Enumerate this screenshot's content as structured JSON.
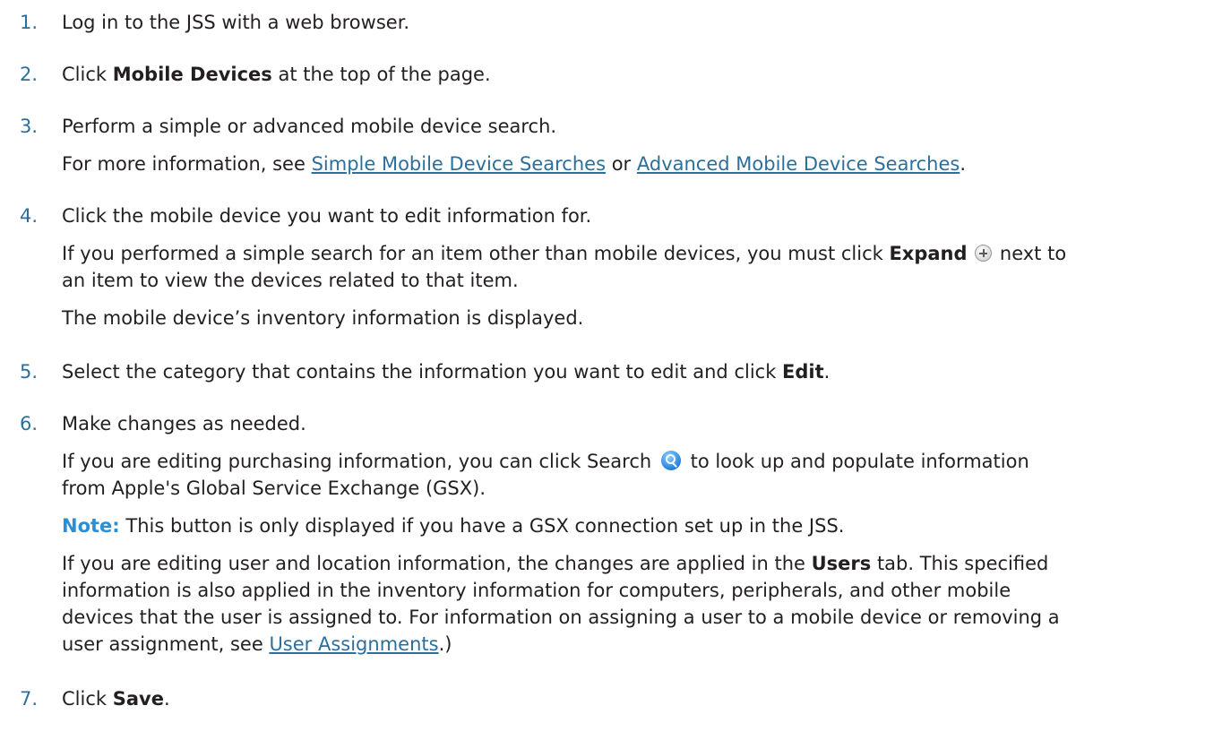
{
  "steps": [
    {
      "num": "1.",
      "text": "Log in to the JSS with a web browser."
    },
    {
      "num": "2.",
      "pre": "Click ",
      "bold": "Mobile Devices",
      "post": " at the top of the page."
    },
    {
      "num": "3.",
      "text": "Perform a simple or advanced mobile device search.",
      "sub_pre": "For more information, see ",
      "link1": "Simple Mobile Device Searches",
      "sub_mid": " or ",
      "link2": "Advanced Mobile Device Searches",
      "sub_post": "."
    },
    {
      "num": "4.",
      "text": "Click the mobile device you want to edit information for.",
      "p1_pre": "If you performed a simple search for an item other than mobile devices, you must click ",
      "p1_bold": "Expand",
      "p1_post1": " next to",
      "p1_post2": "an item to view the devices related to that item.",
      "p2": "The mobile device’s inventory information is displayed."
    },
    {
      "num": "5.",
      "pre": "Select the category that contains the information you want to edit and click ",
      "bold": "Edit",
      "post": "."
    },
    {
      "num": "6.",
      "text": "Make changes as needed.",
      "p1_pre": "If you are editing purchasing information, you can click Search",
      "p1_post1": "to look up and populate information",
      "p1_post2": "from Apple's Global Service Exchange (GSX).",
      "note_label": "Note:",
      "note_text": " This button is only displayed if you have a GSX connection set up in the JSS.",
      "p3_l1_pre": "If you are editing user and location information, the changes are applied in the ",
      "p3_l1_bold": "Users",
      "p3_l1_post": " tab. This specified",
      "p3_l2": "information is also applied in the inventory information for computers, peripherals, and other mobile",
      "p3_l3": "devices that the user is assigned to. For information on assigning a user to a mobile device or removing a",
      "p3_l4_pre": "user assignment, see ",
      "p3_l4_link": "User Assignments",
      "p3_l4_post": ".)"
    },
    {
      "num": "7.",
      "pre": "Click ",
      "bold": "Save",
      "post": "."
    }
  ],
  "icons": {
    "expand": "plus-circle-icon",
    "search": "magnifier-icon"
  },
  "colors": {
    "step_number": "#2b6f9c",
    "link": "#2b6f9c",
    "note_label": "#2b8fd6",
    "text": "#231f20"
  }
}
